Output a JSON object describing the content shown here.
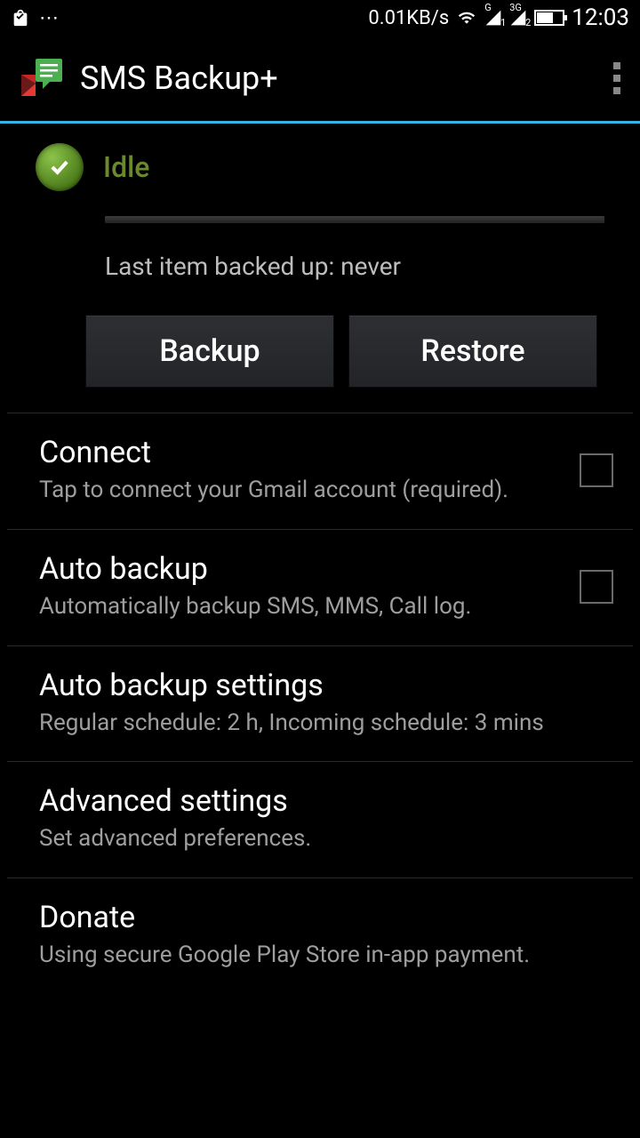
{
  "status_bar": {
    "data_rate": "0.01KB/s",
    "time": "12:03",
    "network1": "G",
    "network2": "3G"
  },
  "app": {
    "title": "SMS Backup+"
  },
  "state": {
    "label": "Idle",
    "last_backup": "Last item backed up: never"
  },
  "buttons": {
    "backup": "Backup",
    "restore": "Restore"
  },
  "settings": [
    {
      "title": "Connect",
      "sub": "Tap to connect your Gmail account (required).",
      "checkbox": true
    },
    {
      "title": "Auto backup",
      "sub": "Automatically backup SMS, MMS, Call log.",
      "checkbox": true
    },
    {
      "title": "Auto backup settings",
      "sub": "Regular schedule: 2 h, Incoming schedule: 3 mins",
      "checkbox": false
    },
    {
      "title": "Advanced settings",
      "sub": "Set advanced preferences.",
      "checkbox": false
    },
    {
      "title": "Donate",
      "sub": "Using secure Google Play Store in-app payment.",
      "checkbox": false
    }
  ]
}
